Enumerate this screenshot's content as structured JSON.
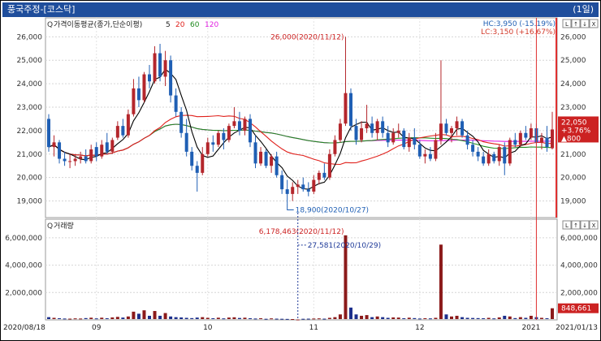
{
  "window": {
    "title": "풍국주정-[코스닥]",
    "period": "(1일)"
  },
  "price_panel": {
    "legend_prefix": "가격이동평균(종가,단순이평)",
    "ma_labels": [
      "5",
      "20",
      "60",
      "120"
    ],
    "ma_colors": [
      "#000000",
      "#e0201b",
      "#1f8a1f",
      "#e11fe1"
    ],
    "hc_label": "HC:3,950 (-15.19%)",
    "lc_label": "LC:3,150 (+16.67%)",
    "high_annot": "26,000(2020/11/12)",
    "low_annot": "18,900(2020/10/27)",
    "current_price": "22,050",
    "current_change": "+3.76%",
    "current_diff": "▲800"
  },
  "volume_panel": {
    "title": "거래량",
    "high_annot": "6,178,463(2020/11/12)",
    "low_annot": "27,581(2020/10/29)",
    "current_volume": "848,661"
  },
  "panel_buttons": [
    "L",
    "↑",
    "↓",
    "X"
  ],
  "colors": {
    "up": "#b4262c",
    "down": "#1f5fb4",
    "title_bar": "#1f4e9c",
    "current_box": "#cc2222"
  },
  "chart_data": {
    "type": "candlestick",
    "price_axis": {
      "ticks": [
        "26,000",
        "25,000",
        "24,000",
        "23,000",
        "22,000",
        "21,000",
        "20,000",
        "19,000"
      ],
      "ylim": [
        18500,
        26600
      ]
    },
    "volume_axis": {
      "ticks": [
        "6,000,000",
        "4,000,000",
        "2,000,000"
      ],
      "ylim": [
        0,
        7000000
      ]
    },
    "x_start_label": "2020/08/18",
    "x_end_label": "2021/01/13",
    "x_month_labels": [
      "09",
      "10",
      "11",
      "12",
      "2021"
    ],
    "x_month_indices": [
      9,
      30,
      50,
      70,
      91
    ],
    "candles": [
      [
        22500,
        22700,
        21100,
        21300
      ],
      [
        21300,
        21800,
        20900,
        21500
      ],
      [
        21500,
        21600,
        20600,
        20800
      ],
      [
        20800,
        21100,
        20500,
        20700
      ],
      [
        20700,
        21000,
        20400,
        20700
      ],
      [
        20700,
        21000,
        20500,
        20800
      ],
      [
        20800,
        21100,
        20600,
        20900
      ],
      [
        20900,
        21200,
        20600,
        20700
      ],
      [
        20700,
        21400,
        20600,
        21200
      ],
      [
        21300,
        21500,
        20700,
        20900
      ],
      [
        20900,
        21600,
        20800,
        21400
      ],
      [
        21500,
        21900,
        21000,
        21100
      ],
      [
        21100,
        21700,
        21000,
        21600
      ],
      [
        21700,
        22400,
        21600,
        22200
      ],
      [
        22200,
        22500,
        21700,
        21800
      ],
      [
        21800,
        22900,
        21700,
        22700
      ],
      [
        22700,
        24200,
        22600,
        23800
      ],
      [
        23800,
        24300,
        23000,
        23300
      ],
      [
        23300,
        24500,
        23200,
        24400
      ],
      [
        24400,
        24800,
        23800,
        24100
      ],
      [
        24100,
        25600,
        24000,
        25300
      ],
      [
        25300,
        25700,
        24100,
        24300
      ],
      [
        24300,
        25400,
        23900,
        25000
      ],
      [
        25000,
        25200,
        23200,
        23500
      ],
      [
        23500,
        23800,
        22600,
        22800
      ],
      [
        22800,
        23000,
        21700,
        21900
      ],
      [
        21900,
        22500,
        20900,
        21100
      ],
      [
        21100,
        21300,
        20300,
        20500
      ],
      [
        20500,
        20700,
        19400,
        20200
      ],
      [
        20200,
        21300,
        20100,
        21000
      ],
      [
        21000,
        21700,
        20900,
        21500
      ],
      [
        21500,
        21800,
        21100,
        21400
      ],
      [
        21400,
        22000,
        21300,
        21900
      ],
      [
        21900,
        22100,
        21200,
        21600
      ],
      [
        21600,
        22300,
        21500,
        22200
      ],
      [
        22200,
        23000,
        22100,
        22400
      ],
      [
        22400,
        22800,
        21800,
        22000
      ],
      [
        22000,
        22600,
        21800,
        22500
      ],
      [
        22500,
        22700,
        21300,
        21500
      ],
      [
        21500,
        21800,
        20400,
        20600
      ],
      [
        20600,
        21300,
        20500,
        21100
      ],
      [
        21100,
        21200,
        20400,
        20500
      ],
      [
        20500,
        21000,
        20200,
        20900
      ],
      [
        20900,
        21100,
        20000,
        20100
      ],
      [
        20100,
        20300,
        19300,
        19500
      ],
      [
        19500,
        19900,
        18900,
        19300
      ],
      [
        19300,
        19800,
        19000,
        19600
      ],
      [
        19600,
        19900,
        19300,
        19700
      ],
      [
        19700,
        20000,
        19400,
        19500
      ],
      [
        19500,
        19800,
        19200,
        19400
      ],
      [
        19400,
        20100,
        19300,
        19900
      ],
      [
        19900,
        20300,
        19700,
        20200
      ],
      [
        20200,
        20600,
        19900,
        20000
      ],
      [
        20000,
        21200,
        19900,
        21000
      ],
      [
        21000,
        21800,
        20900,
        21600
      ],
      [
        21600,
        22500,
        21500,
        22300
      ],
      [
        22300,
        26000,
        22200,
        23600
      ],
      [
        23600,
        23800,
        22000,
        22200
      ],
      [
        22200,
        22500,
        21400,
        21600
      ],
      [
        21600,
        22400,
        21500,
        22100
      ],
      [
        22100,
        23100,
        21900,
        22300
      ],
      [
        22300,
        22600,
        21700,
        21900
      ],
      [
        21900,
        22500,
        21600,
        22400
      ],
      [
        22400,
        22600,
        21700,
        21900
      ],
      [
        21900,
        22200,
        21300,
        21500
      ],
      [
        21500,
        22100,
        21400,
        21900
      ],
      [
        21900,
        22300,
        21700,
        22000
      ],
      [
        22000,
        22100,
        21200,
        21300
      ],
      [
        21300,
        21900,
        21100,
        21700
      ],
      [
        21700,
        22100,
        21200,
        21400
      ],
      [
        21400,
        21600,
        20800,
        20900
      ],
      [
        20900,
        21200,
        20600,
        21000
      ],
      [
        21000,
        21300,
        20700,
        20800
      ],
      [
        20800,
        21900,
        20700,
        21600
      ],
      [
        21600,
        25000,
        21400,
        22300
      ],
      [
        22300,
        22500,
        21800,
        21900
      ],
      [
        21900,
        22200,
        21500,
        22100
      ],
      [
        22100,
        22600,
        21800,
        22400
      ],
      [
        22400,
        22500,
        21700,
        21800
      ],
      [
        21800,
        22000,
        21200,
        21400
      ],
      [
        21400,
        21600,
        20900,
        21100
      ],
      [
        21100,
        21300,
        20700,
        20900
      ],
      [
        20900,
        21100,
        20500,
        20600
      ],
      [
        20600,
        21200,
        20500,
        21000
      ],
      [
        21000,
        21100,
        20600,
        20700
      ],
      [
        20700,
        21400,
        20500,
        21300
      ],
      [
        21300,
        21500,
        20100,
        20600
      ],
      [
        20600,
        21700,
        20500,
        21600
      ],
      [
        21600,
        21900,
        21300,
        21400
      ],
      [
        21400,
        22000,
        21300,
        21900
      ],
      [
        21900,
        22200,
        21600,
        21700
      ],
      [
        21700,
        22300,
        21600,
        22100
      ],
      [
        22100,
        22300,
        21400,
        21500
      ],
      [
        21500,
        21900,
        21200,
        21700
      ],
      [
        21700,
        22200,
        21100,
        21300
      ],
      [
        21250,
        22800,
        21200,
        22050
      ]
    ],
    "volumes": [
      200000,
      150000,
      120000,
      100000,
      90000,
      110000,
      100000,
      130000,
      160000,
      110000,
      160000,
      120000,
      180000,
      220000,
      170000,
      250000,
      600000,
      450000,
      700000,
      300000,
      650000,
      300000,
      500000,
      250000,
      200000,
      180000,
      150000,
      130000,
      170000,
      200000,
      150000,
      120000,
      160000,
      110000,
      170000,
      190000,
      140000,
      160000,
      120000,
      100000,
      120000,
      80000,
      110000,
      90000,
      80000,
      70000,
      60000,
      27581,
      80000,
      90000,
      100000,
      110000,
      90000,
      150000,
      200000,
      400000,
      6178463,
      900000,
      400000,
      300000,
      350000,
      200000,
      250000,
      200000,
      150000,
      180000,
      170000,
      120000,
      160000,
      130000,
      100000,
      120000,
      110000,
      150000,
      5500000,
      400000,
      250000,
      300000,
      200000,
      150000,
      140000,
      130000,
      120000,
      150000,
      110000,
      180000,
      300000,
      250000,
      130000,
      200000,
      150000,
      300000,
      200000,
      150000,
      120000,
      848661
    ]
  }
}
